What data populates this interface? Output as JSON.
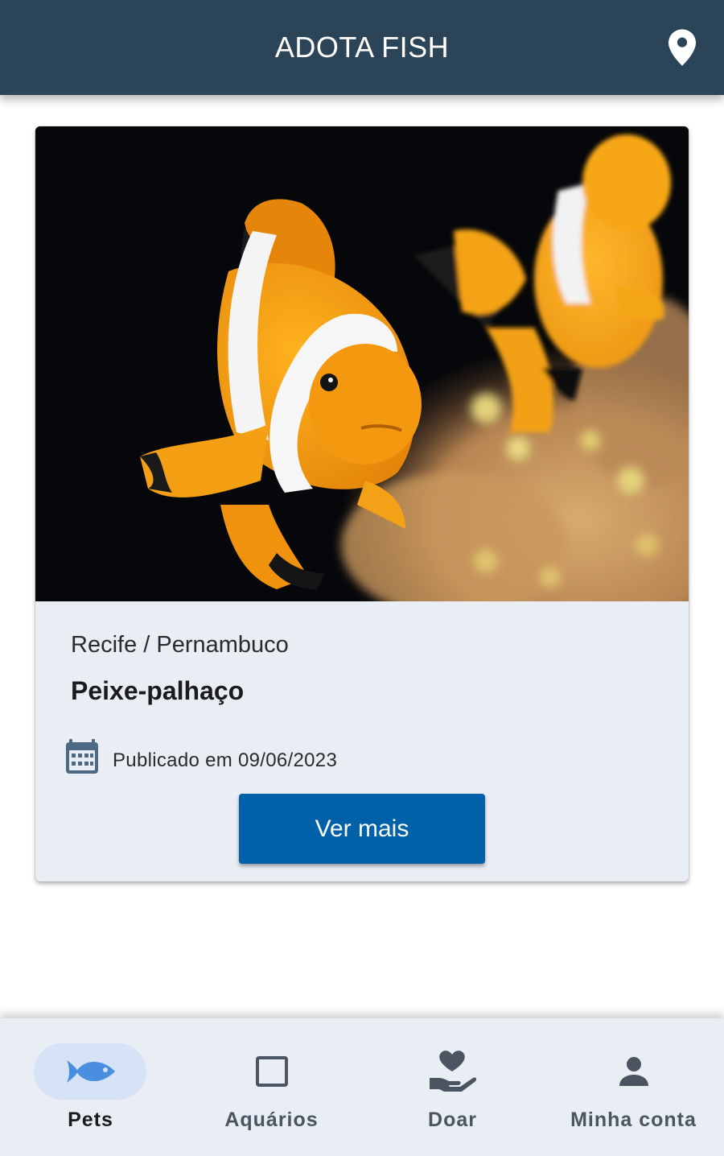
{
  "header": {
    "title": "ADOTA FISH",
    "location_icon": "map-pin-icon"
  },
  "card": {
    "location": "Recife / Pernambuco",
    "name": "Peixe-palhaço",
    "date_label": "Publicado em 09/06/2023",
    "button_label": "Ver mais",
    "calendar_icon": "calendar-icon"
  },
  "nav": {
    "items": [
      {
        "label": "Pets",
        "icon": "fish-icon",
        "active": true
      },
      {
        "label": "Aquários",
        "icon": "square-icon",
        "active": false
      },
      {
        "label": "Doar",
        "icon": "heart-hand-icon",
        "active": false
      },
      {
        "label": "Minha conta",
        "icon": "person-icon",
        "active": false
      }
    ]
  },
  "colors": {
    "app_bar": "#2c4457",
    "primary_button": "#0060a8",
    "card_background": "#e9eef5",
    "nav_active_pill": "#d6e3f7",
    "fish_icon": "#4a8ee0"
  }
}
